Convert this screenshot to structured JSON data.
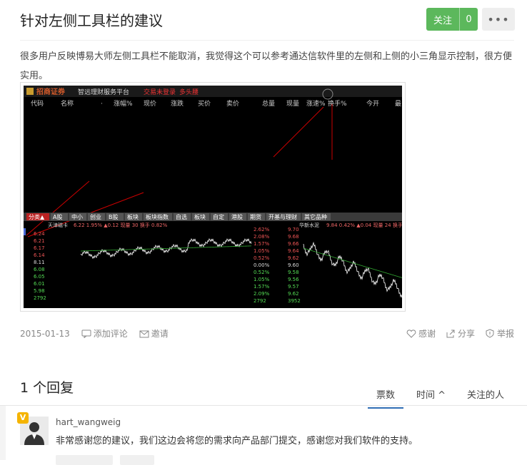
{
  "question": {
    "title": "针对左侧工具栏的建议",
    "follow_label": "关注",
    "follow_count": "0",
    "body": "很多用户反映博易大师左侧工具栏不能取消，我觉得这个可以参考通达信软件里的左侧和上侧的小三角显示控制，很方便实用。",
    "date": "2015-01-13",
    "actions_left": [
      "添加评论",
      "邀请"
    ],
    "actions_right": [
      "感谢",
      "分享",
      "举报"
    ]
  },
  "screenshot": {
    "brand": "招商证券",
    "platform": "智远理财服务平台",
    "status1": "交易未登录",
    "status2": "多头腰",
    "columns": [
      "代码",
      "名称",
      "·",
      "涨幅%",
      "现价",
      "涨跌",
      "买价",
      "卖价",
      "总量",
      "现量",
      "涨速%",
      "换手%",
      "今开",
      "最"
    ],
    "tabs": [
      "分类▲",
      "A股",
      "中小",
      "创业",
      "B股",
      "板块",
      "板块指数",
      "自选",
      "板块",
      "自定",
      "港股",
      "期货",
      "开基与理财",
      "其它品种"
    ],
    "left_chart": {
      "name": "天津磁卡",
      "info": "6.22 1.95% ▲0.12 现量 30 换手 0.82%",
      "prices": [
        "6.24",
        "6.21",
        "6.17",
        "6.14",
        "8.11",
        "6.08",
        "6.05",
        "6.01",
        "5.98",
        "2792"
      ],
      "pcts": [
        "2.62%",
        "2.08%",
        "1.57%",
        "1.05%",
        "0.52%",
        "0.00%",
        "0.52%",
        "1.05%",
        "1.57%",
        "2.09%",
        "2792"
      ]
    },
    "right_chart": {
      "name": "华新水泥",
      "info": "9.84 0.42% ▲0.04 现量 24 换手",
      "prices": [
        "9.70",
        "9.68",
        "9.66",
        "9.64",
        "9.62",
        "9.60",
        "9.58",
        "9.56",
        "9.57",
        "9.62",
        "3952"
      ]
    }
  },
  "replies": {
    "title": "1 个回复",
    "tabs": [
      "票数",
      "时间 ^",
      "关注的人"
    ],
    "items": [
      {
        "user": "hart_wangweig",
        "badge": "V",
        "text": "非常感谢您的建议，我们这边会将您的需求向产品部门提交，感谢您对我们软件的支持。"
      }
    ]
  },
  "colors": {
    "accent_green": "#5cb85c",
    "tab_blue": "#2f6db5",
    "badge_yellow": "#f5b400"
  }
}
